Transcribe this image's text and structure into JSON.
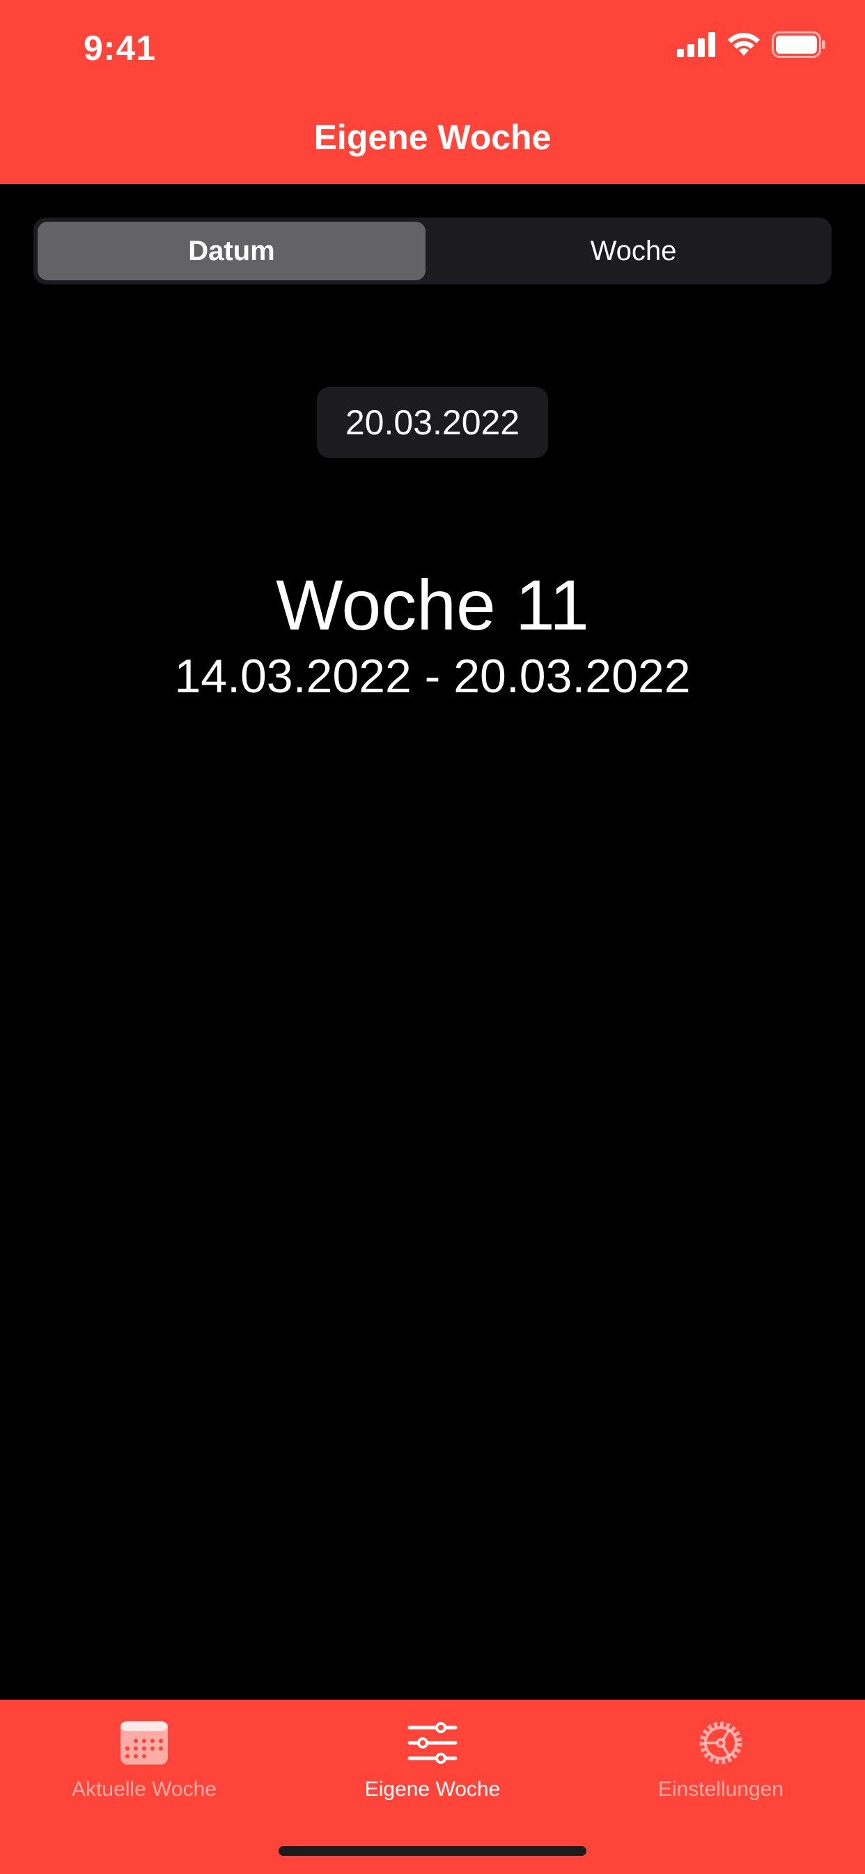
{
  "status_bar": {
    "time": "9:41"
  },
  "nav": {
    "title": "Eigene Woche"
  },
  "segmented": {
    "options": [
      "Datum",
      "Woche"
    ],
    "selected": "Datum"
  },
  "date_picker": {
    "value": "20.03.2022"
  },
  "week": {
    "title": "Woche 11",
    "range": "14.03.2022 - 20.03.2022"
  },
  "tabs": [
    {
      "label": "Aktuelle Woche",
      "icon": "calendar-icon",
      "active": false
    },
    {
      "label": "Eigene Woche",
      "icon": "sliders-icon",
      "active": true
    },
    {
      "label": "Einstellungen",
      "icon": "gear-icon",
      "active": false
    }
  ],
  "colors": {
    "accent": "#FF453A",
    "background": "#000000",
    "control_bg": "#1C1C1E",
    "segment_selected": "#636366"
  }
}
